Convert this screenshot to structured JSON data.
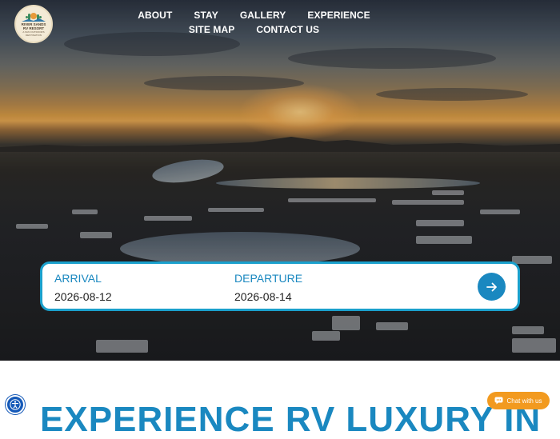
{
  "header": {
    "logo": {
      "name": "RIVER SANDS",
      "line2": "RV RESORT",
      "tagline": "A SUN OUTDOORS DESTINATION"
    },
    "nav": [
      "ABOUT",
      "STAY",
      "GALLERY",
      "EXPERIENCE",
      "SITE MAP",
      "CONTACT US"
    ]
  },
  "booking": {
    "arrival_label": "ARRIVAL",
    "arrival_value": "2026-08-12",
    "departure_label": "DEPARTURE",
    "departure_value": "2026-08-14",
    "submit_icon": "arrow-right-icon"
  },
  "headline": "EXPERIENCE RV LUXURY IN",
  "chat": {
    "label": "Chat with us",
    "icon": "chat-bubble-icon"
  },
  "accessibility": {
    "icon": "accessibility-icon"
  },
  "colors": {
    "accent": "#1a88c0",
    "booking_border": "#1aa0cc",
    "chat": "#f29a1f",
    "accessibility": "#1459b8"
  }
}
